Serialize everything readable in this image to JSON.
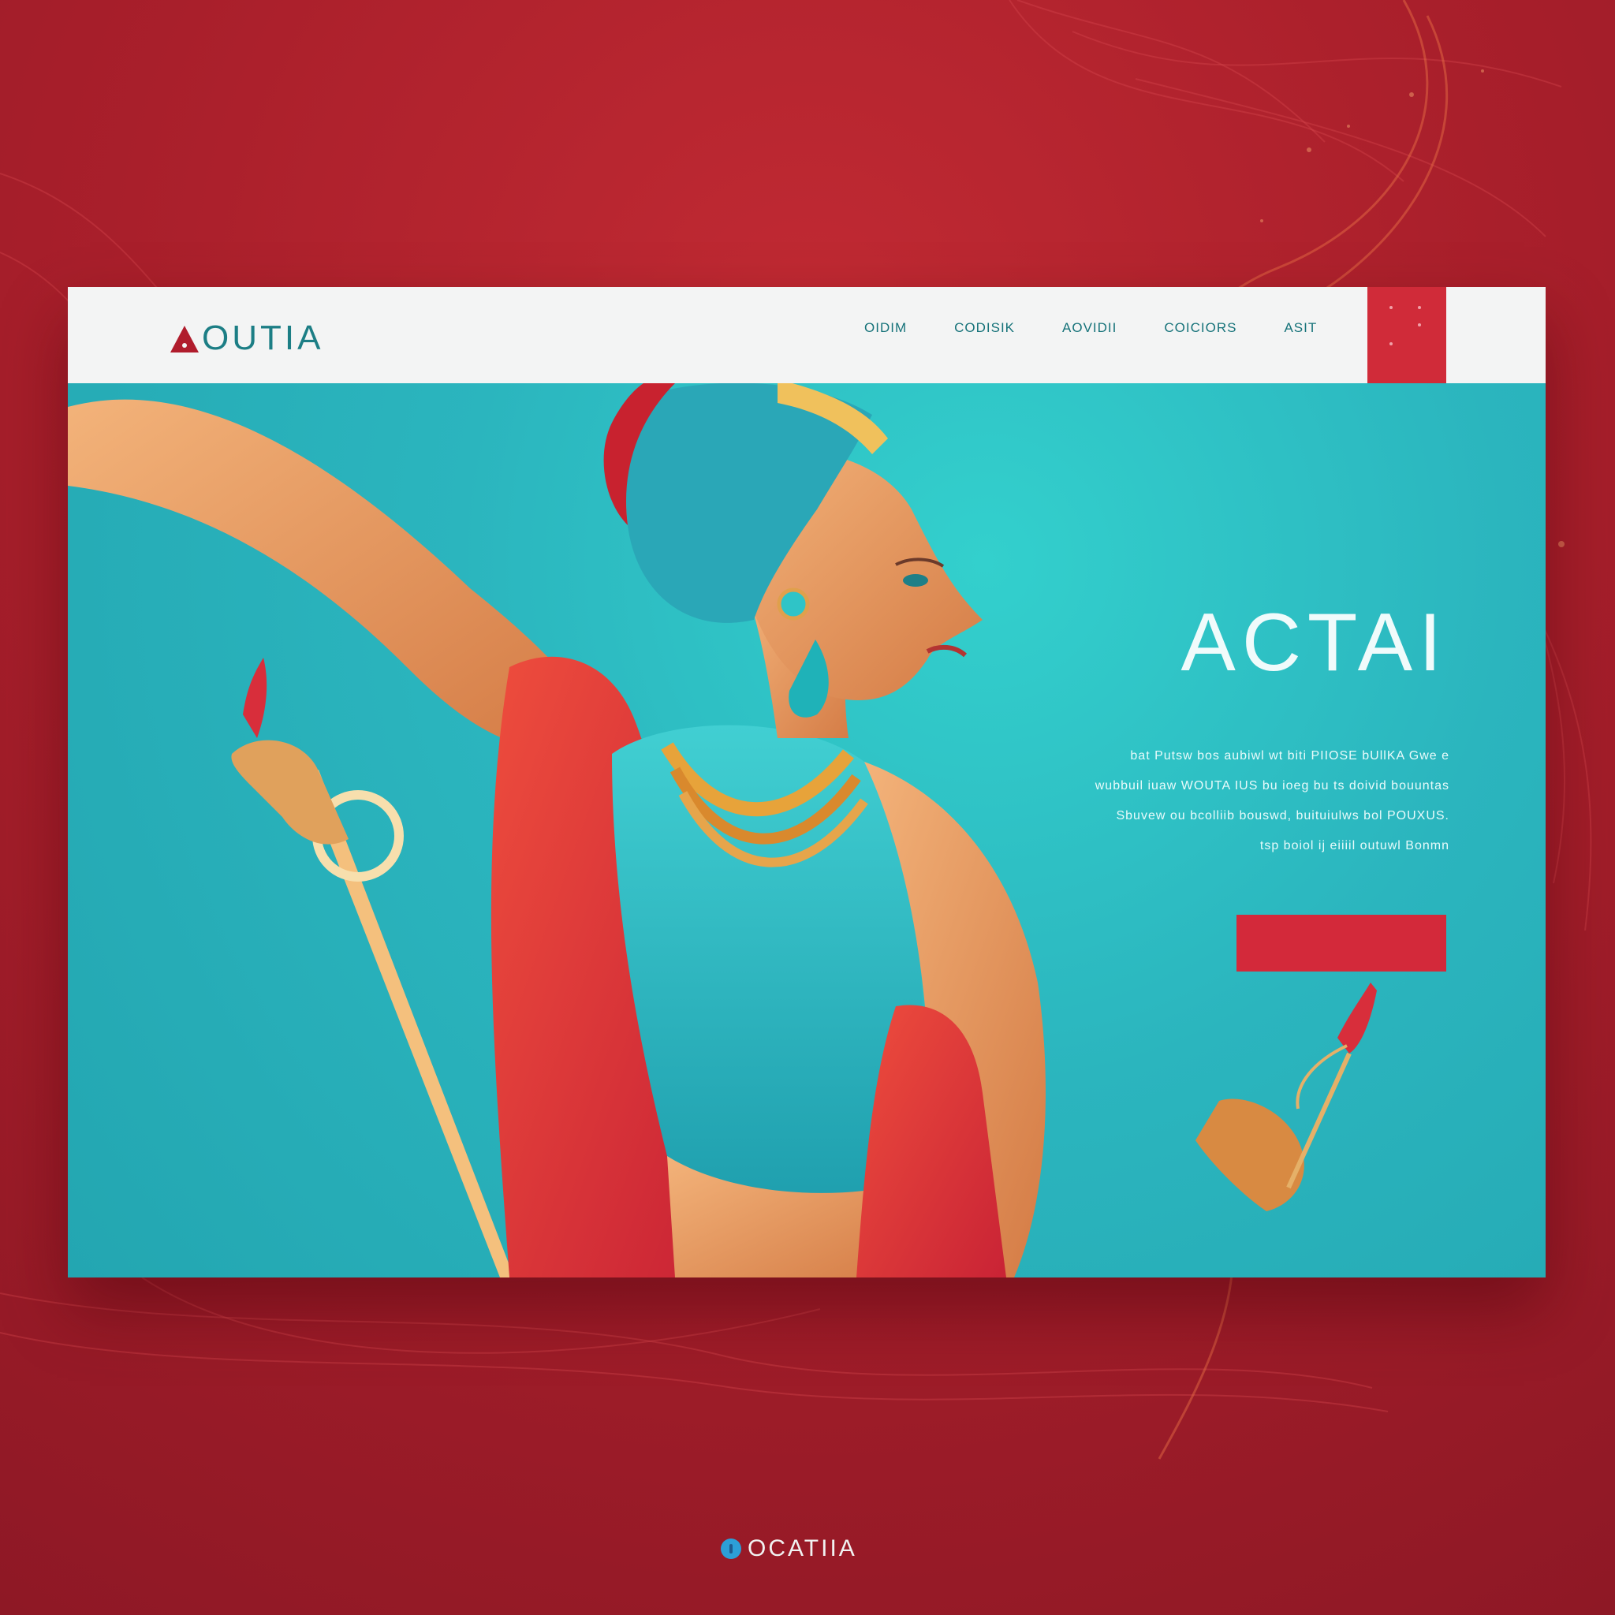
{
  "brand": {
    "logo_text": "OUTIA",
    "tagline": "",
    "footer_name": "OCATIIA",
    "footer_tagline": ""
  },
  "nav": {
    "links": [
      "OIDIM",
      "CODISIK",
      "AOVIDII",
      "COICIORS",
      "ASIT"
    ]
  },
  "hero": {
    "title": "ACTAI",
    "copy": [
      "bat Putsw bos aubiwl wt biti PIIOSE bUllKA Gwe e",
      "wubbuil iuaw WOUTA IUS bu ioeg bu ts doivid bouuntas",
      "Sbuvew ou bcolliib bouswd, buituiulws bol POUXUS.",
      "tsp boiol ij eiiiil outuwl Bonmn"
    ],
    "cta_label": ""
  },
  "colors": {
    "background_red": "#a91f2b",
    "accent_red": "#d3293a",
    "teal": "#2bb5be",
    "nav_text": "#157279",
    "footer_icon_blue": "#2c9fd7"
  },
  "icons": {
    "logo_mark": "triangle-logo-icon",
    "footer_mark": "blue-dot-logo-icon"
  }
}
